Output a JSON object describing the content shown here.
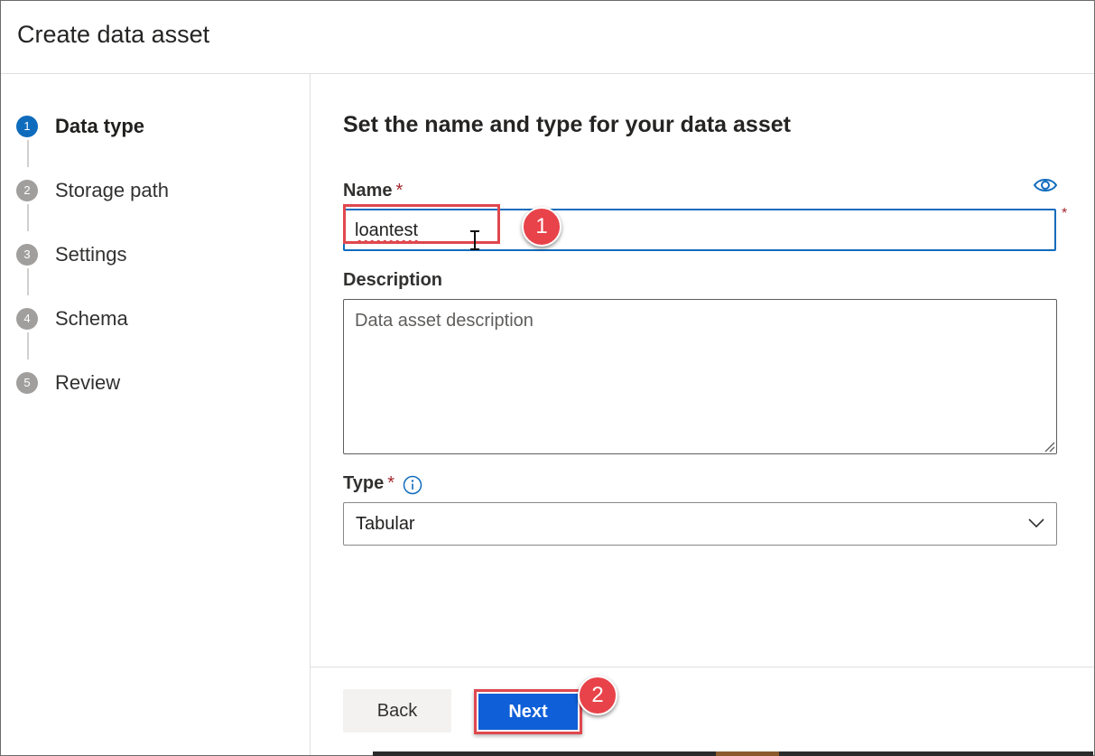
{
  "window": {
    "title": "Create data asset"
  },
  "steps": [
    {
      "number": "1",
      "label": "Data type",
      "active": true
    },
    {
      "number": "2",
      "label": "Storage path",
      "active": false
    },
    {
      "number": "3",
      "label": "Settings",
      "active": false
    },
    {
      "number": "4",
      "label": "Schema",
      "active": false
    },
    {
      "number": "5",
      "label": "Review",
      "active": false
    }
  ],
  "form": {
    "section_title": "Set the name and type for your data asset",
    "name": {
      "label": "Name",
      "required_mark": "*",
      "value": "loantest"
    },
    "description": {
      "label": "Description",
      "placeholder": "Data asset description",
      "value": ""
    },
    "type": {
      "label": "Type",
      "required_mark": "*",
      "value": "Tabular"
    }
  },
  "annotations": {
    "badge_1": "1",
    "badge_2": "2"
  },
  "footer": {
    "back_label": "Back",
    "next_label": "Next"
  },
  "icons": {
    "eye": "eye-icon",
    "info": "info-icon",
    "chevron": "chevron-down-icon",
    "resize": "resize-grip-icon",
    "cursor": "text-cursor-icon"
  },
  "colors": {
    "accent": "#0f6cbd",
    "next_button": "#0f5fd8",
    "highlight": "#e0484f",
    "required": "#a4262c"
  }
}
